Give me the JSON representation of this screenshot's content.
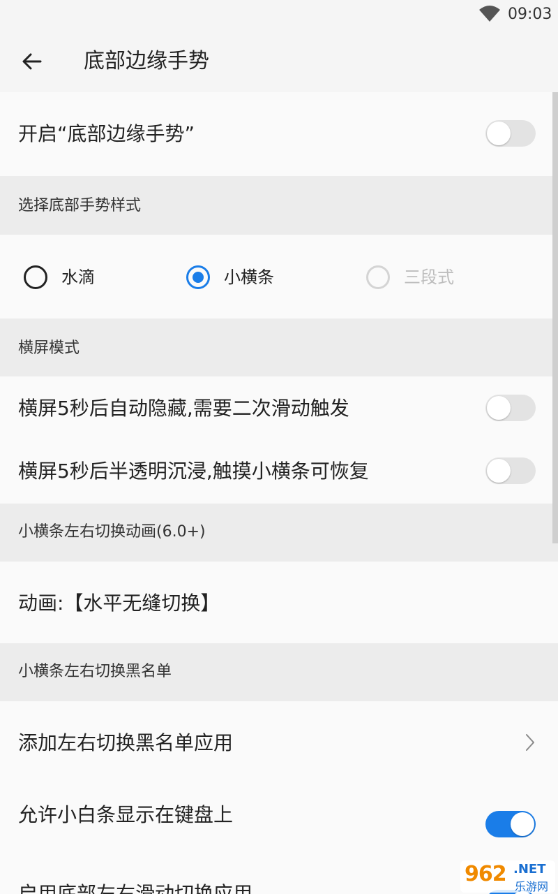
{
  "status_bar": {
    "time": "09:03",
    "wifi_icon": "wifi-icon"
  },
  "app_bar": {
    "title": "底部边缘手势",
    "back_icon": "back-arrow-icon"
  },
  "main_toggle": {
    "label": "开启“底部边缘手势”",
    "on": false
  },
  "sections": {
    "gesture_style": "选择底部手势样式",
    "landscape": "横屏模式",
    "switch_anim": "小横条左右切换动画(6.0+)",
    "blacklist": "小横条左右切换黑名单"
  },
  "gesture_style": {
    "options": [
      {
        "label": "水滴",
        "checked": false,
        "disabled": false
      },
      {
        "label": "小横条",
        "checked": true,
        "disabled": false
      },
      {
        "label": "三段式",
        "checked": false,
        "disabled": true
      }
    ]
  },
  "landscape": {
    "auto_hide": {
      "label": "横屏5秒后自动隐藏,需要二次滑动触发",
      "on": false
    },
    "translucent": {
      "label": "横屏5秒后半透明沉浸,触摸小横条可恢复",
      "on": false
    }
  },
  "animation": {
    "label": "动画:【水平无缝切换】"
  },
  "blacklist": {
    "add_app": {
      "label": "添加左右切换黑名单应用",
      "chevron_icon": "chevron-right-icon"
    },
    "show_on_keyboard": {
      "label": "允许小白条显示在键盘上",
      "on": true
    },
    "partial_row": {
      "label": "启用底部左右滑动切换应用"
    }
  },
  "watermark": {
    "num": "962",
    "net": ".NET",
    "sub": "乐游网"
  },
  "colors": {
    "accent": "#1a7de8",
    "switch_off": "#e3e3e3",
    "section_bg": "#ececec"
  }
}
